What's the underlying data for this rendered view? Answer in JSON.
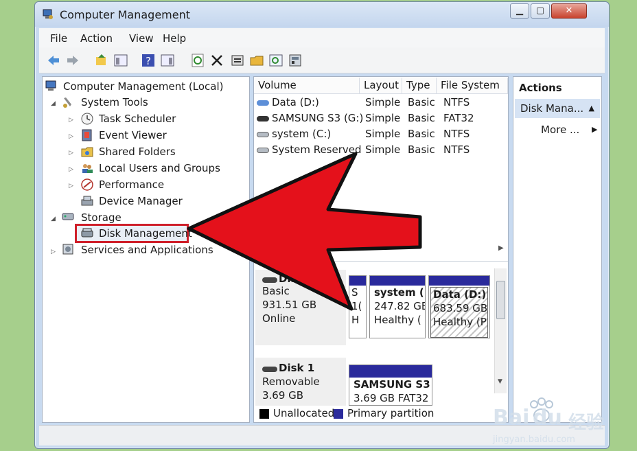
{
  "window": {
    "title": "Computer Management"
  },
  "window_controls": {
    "minimize": "▁",
    "maximize": "▢",
    "close": "✕"
  },
  "menu": [
    "File",
    "Action",
    "View",
    "Help"
  ],
  "toolbar_icons": [
    "back-icon",
    "forward-icon",
    "up-icon",
    "show-hide-tree-icon",
    "help-icon",
    "show-hide-action-icon",
    "refresh-icon",
    "delete-icon",
    "properties-icon",
    "open-icon",
    "search-icon",
    "export-icon"
  ],
  "tree": {
    "root": "Computer Management (Local)",
    "system_tools": "System Tools",
    "task_scheduler": "Task Scheduler",
    "event_viewer": "Event Viewer",
    "shared_folders": "Shared Folders",
    "local_users": "Local Users and Groups",
    "performance": "Performance",
    "device_manager": "Device Manager",
    "storage": "Storage",
    "disk_management": "Disk Management",
    "services": "Services and Applications"
  },
  "volume_table": {
    "columns": [
      "Volume",
      "Layout",
      "Type",
      "File System"
    ],
    "rows": [
      {
        "volume": "Data (D:)",
        "layout": "Simple",
        "type": "Basic",
        "fs": "NTFS"
      },
      {
        "volume": "SAMSUNG S3 (G:)",
        "layout": "Simple",
        "type": "Basic",
        "fs": "FAT32"
      },
      {
        "volume": "system (C:)",
        "layout": "Simple",
        "type": "Basic",
        "fs": "NTFS"
      },
      {
        "volume": "System Reserved",
        "layout": "Simple",
        "type": "Basic",
        "fs": "NTFS"
      }
    ]
  },
  "disks": {
    "disk0": {
      "name": "Disk",
      "type": "Basic",
      "size": "931.51 GB",
      "status": "Online",
      "partitions": [
        {
          "line1": "S",
          "line2": "1(",
          "line3": "H"
        },
        {
          "line1": "system  (",
          "line2": "247.82 GE",
          "line3": "Healthy ("
        },
        {
          "line1": "Data  (D:)",
          "line2": "683.59 GB",
          "line3": "Healthy (P"
        }
      ]
    },
    "disk1": {
      "name": "Disk 1",
      "type": "Removable",
      "size": "3.69 GB",
      "partitions": [
        {
          "line1": "SAMSUNG S3",
          "line2": "3.69 GB FAT32"
        }
      ]
    }
  },
  "legend": {
    "unallocated": "Unallocated",
    "primary": "Primary partition",
    "unallocated_color": "#000000",
    "primary_color": "#2a2a9c"
  },
  "actions": {
    "header": "Actions",
    "selected": "Disk Mana...",
    "more": "More ..."
  },
  "watermark": {
    "brand": "Bai",
    "brand_du": "du",
    "cn": "经验",
    "url": "jingyan.baidu.com"
  },
  "annotation": {
    "arrow_color": "#e4111b",
    "highlight_color": "#e4111b"
  }
}
